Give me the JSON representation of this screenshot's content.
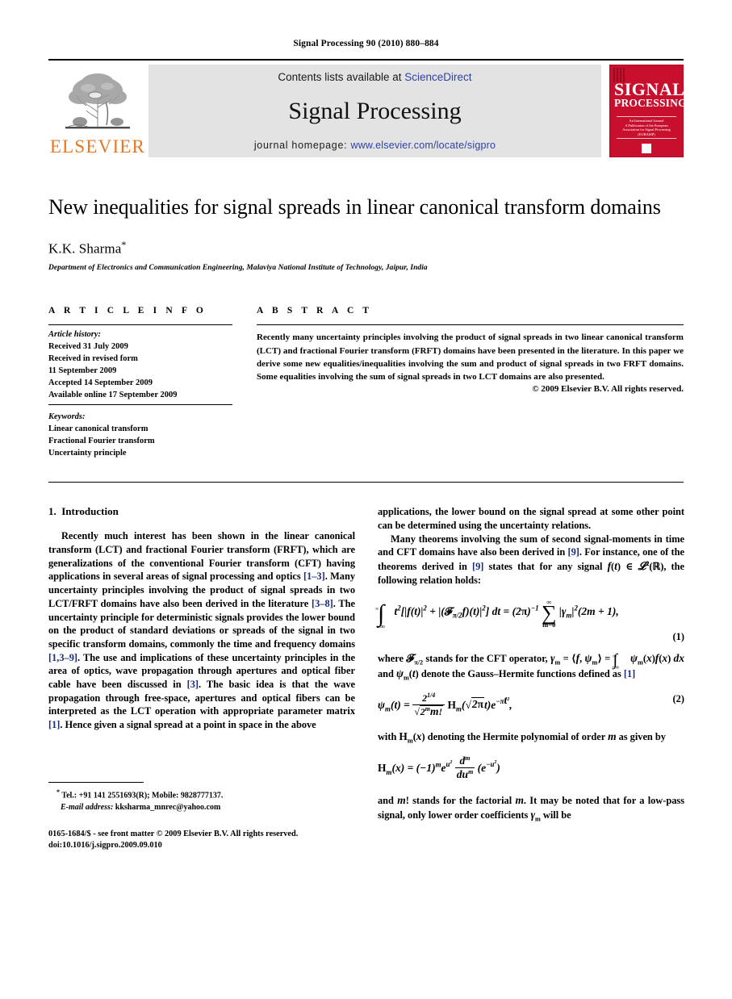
{
  "running_head": "Signal Processing 90 (2010) 880–884",
  "masthead": {
    "publisher_name": "ELSEVIER",
    "contents_prefix": "Contents lists available at",
    "contents_link": "ScienceDirect",
    "journal_name": "Signal Processing",
    "homepage_prefix": "journal homepage:",
    "homepage_link": "www.elsevier.com/locate/sigpro",
    "cover": {
      "line1": "SIGNAL",
      "line2": "PROCESSING",
      "strip_line1": "An International Journal",
      "strip_line2": "A Publication of the European Association for Signal Processing (EURASIP)"
    },
    "link_color": "#2f41a8",
    "band_color": "#e3e3e3",
    "cover_color": "#c8102e",
    "elsevier_orange": "#e87722"
  },
  "title": "New inequalities for signal spreads in linear canonical transform domains",
  "authors": "K.K. Sharma",
  "author_footnote_marker": "*",
  "affiliation": "Department of Electronics and Communication Engineering, Malaviya National Institute of Technology, Jaipur, India",
  "article_info": {
    "heading": "A R T I C L E   I N F O",
    "history_label": "Article history:",
    "history": [
      "Received 31 July 2009",
      "Received in revised form",
      "11 September 2009",
      "Accepted 14 September 2009",
      "Available online 17 September 2009"
    ],
    "keywords_label": "Keywords:",
    "keywords": [
      "Linear canonical transform",
      "Fractional Fourier transform",
      "Uncertainty principle"
    ]
  },
  "abstract": {
    "heading": "A B S T R A C T",
    "text": "Recently many uncertainty principles involving the product of signal spreads in two linear canonical transform (LCT) and fractional Fourier transform (FRFT) domains have been presented in the literature. In this paper we derive some new equalities/inequalities involving the sum and product of signal spreads in two FRFT domains. Some equalities involving the sum of signal spreads in two LCT domains are also presented.",
    "copyright": "© 2009 Elsevier B.V. All rights reserved."
  },
  "body": {
    "section_number": "1.",
    "section_title": "Introduction",
    "left_paragraphs": [
      "Recently much interest has been shown in the linear canonical transform (LCT) and fractional Fourier transform (FRFT), which are generalizations of the conventional Fourier transform (CFT) having applications in several areas of signal processing and optics [1–3]. Many uncertainty principles involving the product of signal spreads in two LCT/FRFT domains have also been derived in the literature [3–8]. The uncertainty principle for deterministic signals provides the lower bound on the product of standard deviations or spreads of the signal in two specific transform domains, commonly the time and frequency domains [1,3–9]. The use and implications of these uncertainty principles in the area of optics, wave propagation through apertures and optical fiber cable have been discussed in [3]. The basic idea is that the wave propagation through free-space, apertures and optical fibers can be interpreted as the LCT operation with appropriate parameter matrix [1]. Hence given a signal spread at a point in space in the above"
    ],
    "right_paragraphs": [
      "applications, the lower bound on the signal spread at some other point can be determined using the uncertainty relations.",
      "Many theorems involving the sum of second signal-moments in time and CFT domains have also been derived in [9]. For instance, one of the theorems derived in [9] states that for any signal f(t) ∈ 𝓛²(ℝ), the following relation holds:"
    ],
    "right_paragraphs_tail": [
      "where 𝓕π/2 stands for the CFT operator, γm = ⟨f, ψm⟩ = ∫−∞∞ ψm(x)f(x) dx and ψm(t) denote the Gauss–Hermite functions defined as [1]",
      "with Hm(x) denoting the Hermite polynomial of order m as given by",
      "and m! stands for the factorial m. It may be noted that for a low-pass signal, only lower order coefficients γm will be"
    ],
    "equation_numbers": [
      "(1)",
      "(2)"
    ]
  },
  "footnote": {
    "marker": "*",
    "tel": "Tel.: +91 141 2551693(R); Mobile: 9828777137.",
    "email_label": "E-mail address:",
    "email": "kksharma_mnrec@yahoo.com"
  },
  "footer": {
    "issn_line": "0165-1684/$ - see front matter © 2009 Elsevier B.V. All rights reserved.",
    "doi_line": "doi:10.1016/j.sigpro.2009.09.010"
  }
}
